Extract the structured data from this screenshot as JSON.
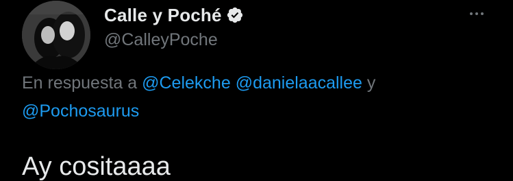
{
  "author": {
    "display_name": "Calle y Poché",
    "handle": "@CalleyPoche",
    "verified": true,
    "avatar_icon": "profile-photo-avatar"
  },
  "menu": {
    "icon": "more-horizontal-icon"
  },
  "reply": {
    "prefix": "En respuesta a",
    "mentions": [
      "@Celekche",
      "@danielaacallee"
    ],
    "joiner": "y",
    "last_mention": "@Pochosaurus"
  },
  "tweet": {
    "text": "Ay cositaaaa"
  },
  "colors": {
    "background": "#000000",
    "primary_text": "#e7e9ea",
    "secondary_text": "#71767b",
    "link": "#1d9bf0"
  }
}
